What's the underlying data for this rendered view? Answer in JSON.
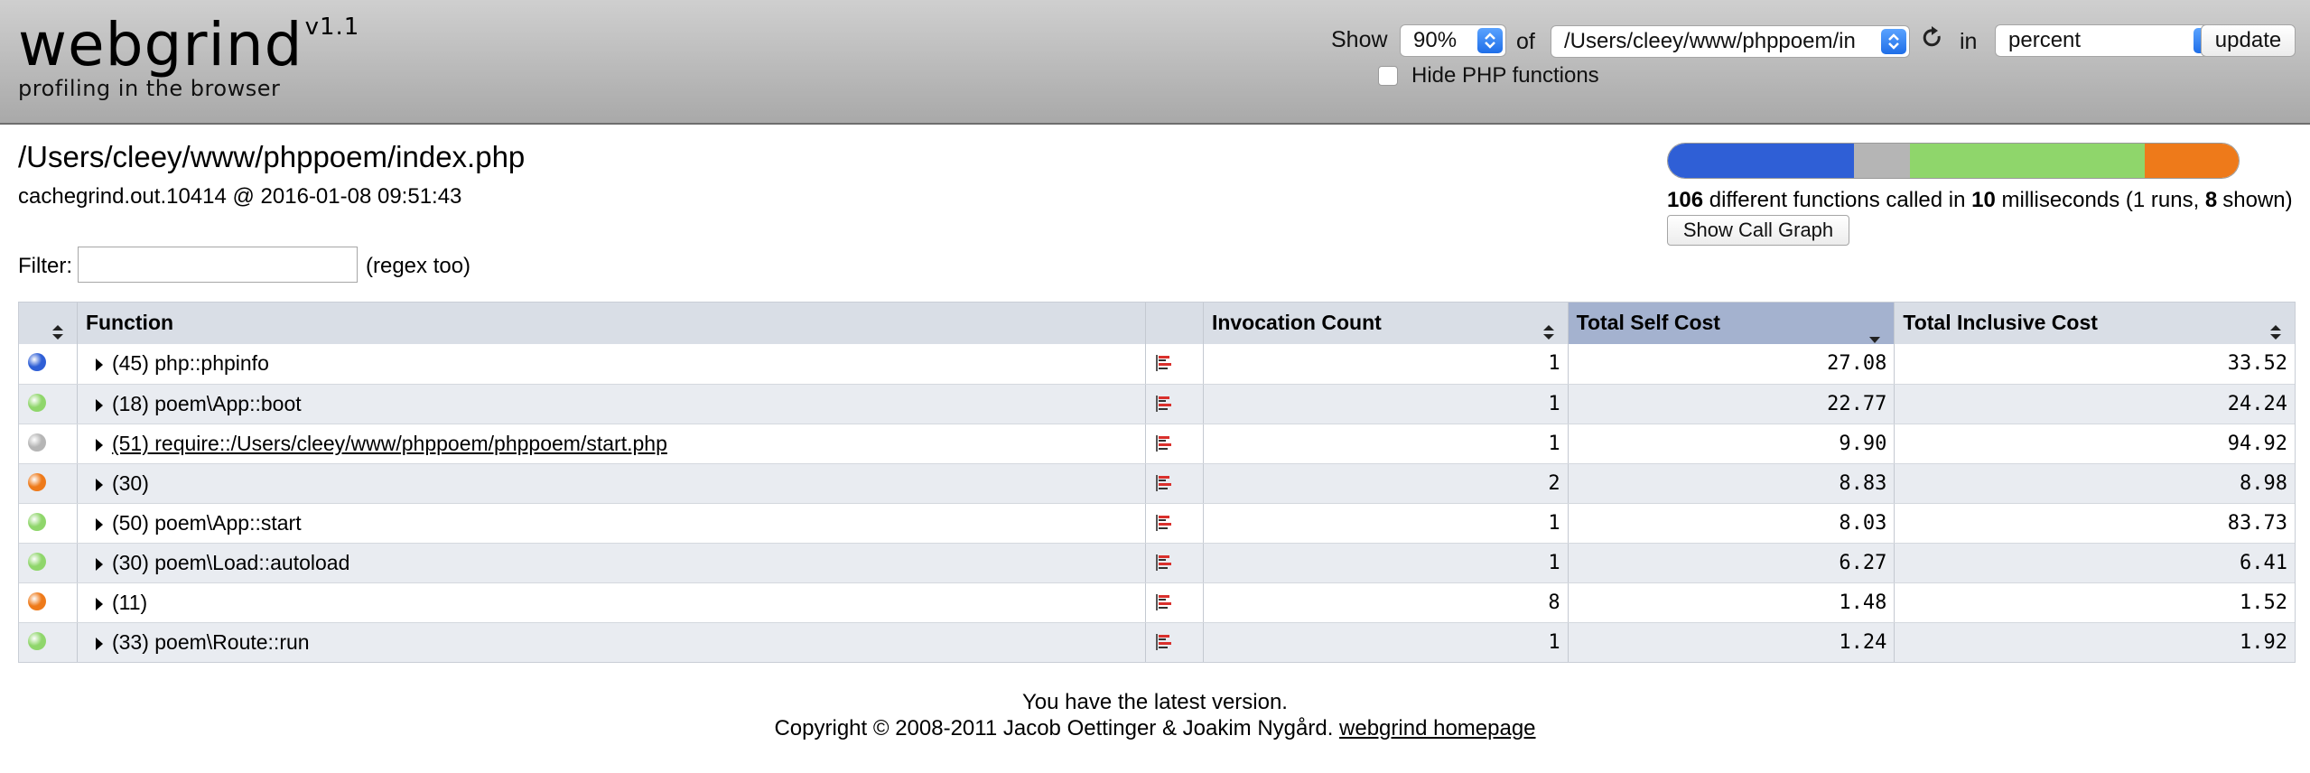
{
  "app": {
    "logo_text": "webgrind",
    "version": "v1.1",
    "tagline": "profiling in the browser"
  },
  "controls": {
    "show_label": "Show",
    "percent_value": "90%",
    "of_label": "of",
    "file_value": "/Users/cleey/www/phppoem/in",
    "in_label": "in",
    "unit_value": "percent",
    "update_label": "update",
    "hide_php_label": "Hide PHP functions",
    "hide_php_checked": false
  },
  "summary": {
    "file_path": "/Users/cleey/www/phppoem/index.php",
    "cachegrind": "cachegrind.out.10414 @ 2016-01-08 09:51:43",
    "functions_count": "106",
    "functions_text": "different functions called in",
    "milliseconds": "10",
    "ms_text": "milliseconds (1 runs,",
    "shown": "8",
    "shown_text": "shown)",
    "call_graph_label": "Show Call Graph",
    "cost_bar": [
      {
        "color": "#2f5fd6",
        "fraction": 0.326
      },
      {
        "color": "#b5b5b5",
        "fraction": 0.098
      },
      {
        "color": "#8fd66b",
        "fraction": 0.412
      },
      {
        "color": "#ee7a1a",
        "fraction": 0.164
      }
    ]
  },
  "filter": {
    "label": "Filter:",
    "value": "",
    "hint": "(regex too)"
  },
  "table": {
    "headers": {
      "function": "Function",
      "invocation": "Invocation Count",
      "self": "Total Self Cost",
      "inclusive": "Total Inclusive Cost"
    },
    "rows": [
      {
        "dot": "#2f5fd6",
        "function": "(45) php::phpinfo",
        "link": false,
        "invocations": "1",
        "self": "27.08",
        "inclusive": "33.52"
      },
      {
        "dot": "#8fd66b",
        "function": "(18) poem\\App::boot",
        "link": false,
        "invocations": "1",
        "self": "22.77",
        "inclusive": "24.24"
      },
      {
        "dot": "#b5b5b5",
        "function": "(51) require::/Users/cleey/www/phppoem/phppoem/start.php",
        "link": true,
        "invocations": "1",
        "self": "9.90",
        "inclusive": "94.92"
      },
      {
        "dot": "#ee7a1a",
        "function": "(30)",
        "link": false,
        "invocations": "2",
        "self": "8.83",
        "inclusive": "8.98"
      },
      {
        "dot": "#8fd66b",
        "function": "(50) poem\\App::start",
        "link": false,
        "invocations": "1",
        "self": "8.03",
        "inclusive": "83.73"
      },
      {
        "dot": "#8fd66b",
        "function": "(30) poem\\Load::autoload",
        "link": false,
        "invocations": "1",
        "self": "6.27",
        "inclusive": "6.41"
      },
      {
        "dot": "#ee7a1a",
        "function": "(11)",
        "link": false,
        "invocations": "8",
        "self": "1.48",
        "inclusive": "1.52"
      },
      {
        "dot": "#8fd66b",
        "function": "(33) poem\\Route::run",
        "link": false,
        "invocations": "1",
        "self": "1.24",
        "inclusive": "1.92"
      }
    ]
  },
  "footer": {
    "version_note": "You have the latest version.",
    "copyright": "Copyright © 2008-2011 Jacob Oettinger & Joakim Nygård.",
    "homepage_link": "webgrind homepage"
  }
}
